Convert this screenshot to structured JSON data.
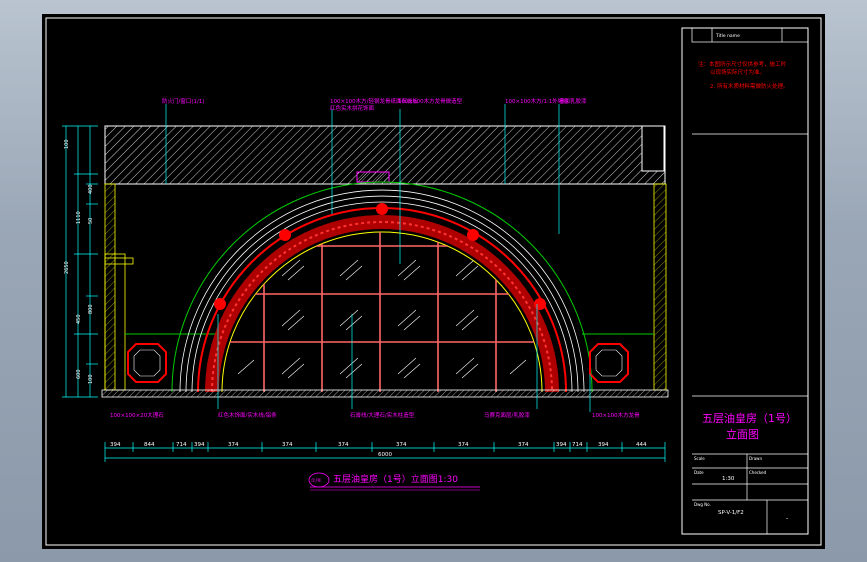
{
  "drawing": {
    "title_label": "五层油皇房（1号）立面图1:30",
    "title_prefix": "①/⑥",
    "dimensions_bottom": [
      "394",
      "844",
      "714",
      "394",
      "374",
      "374",
      "374",
      "374",
      "374",
      "374",
      "394",
      "714",
      "394",
      "444"
    ],
    "dimensions_total": "6000",
    "dimensions_left": [
      "100",
      "1110",
      "400",
      "2650",
      "450",
      "50",
      "800",
      "600",
      "100"
    ],
    "annotations_top": [
      "防火门/窗口(1/1)",
      "100×100木方/轻钢龙骨纸面石膏板",
      "红色实木拼花饰面",
      "100×100木方龙骨做造型",
      "100×100木方/1:1外墙色",
      "墙面乳胶漆"
    ],
    "annotations_bottom": [
      "100×100×20大理石",
      "红色木饰面/实木线/铝条",
      "石膏线/大理石/实木柱造型",
      "马赛克面层/乳胶漆",
      "100×100木方龙骨"
    ]
  },
  "title_block": {
    "header_left": "Title name",
    "header_right": "",
    "notes": [
      "注：本图所示尺寸仅供参考，施工时",
      "以现场实际尺寸为准。",
      "2. 所有木质材料需做防火处理。"
    ],
    "drawing_name": "五层油皇房（1号）",
    "drawing_name_2": "立面图",
    "scale_label": "Scale",
    "scale_value": "1:30",
    "date_label": "Date",
    "drawn_label": "Drawn",
    "checked_label": "Checked",
    "dwg_label": "Dwg No.",
    "dwg_value": "SP-V-1/F2",
    "sheet_value": "-"
  },
  "colors": {
    "background": "#000000",
    "frame": "#ffffff",
    "dimension": "#00ffff",
    "text_magenta": "#ff00ff",
    "arch_red": "#cc0000",
    "arch_green": "#00cc00",
    "title_block_text": "#ff0000"
  }
}
